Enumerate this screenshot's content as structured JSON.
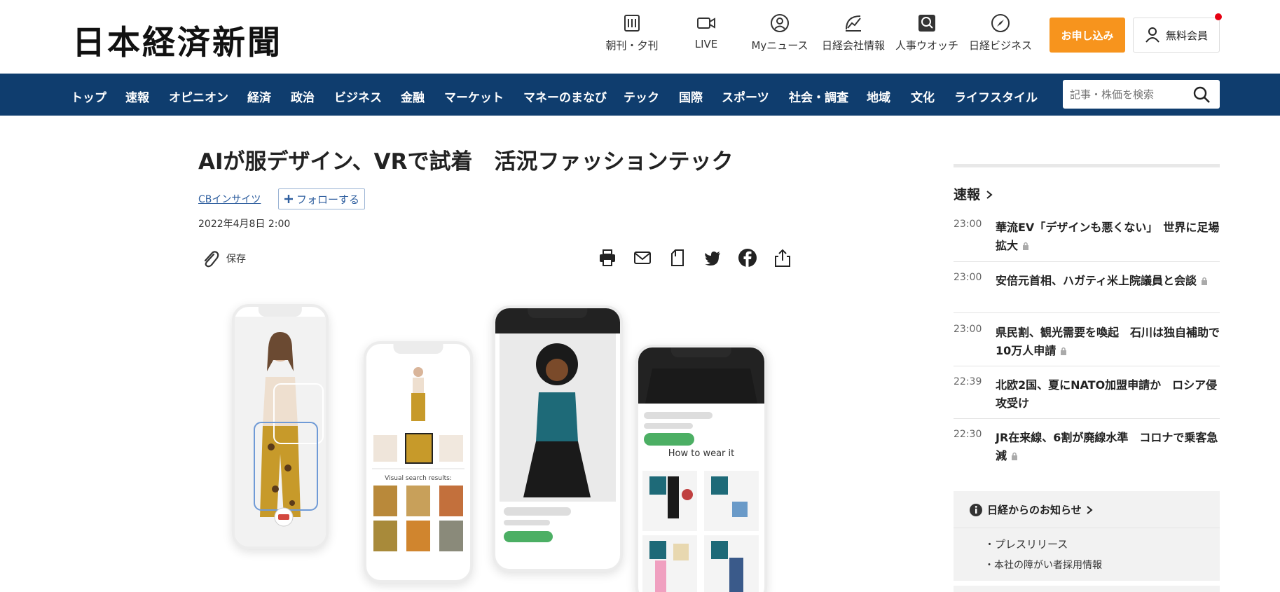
{
  "header": {
    "logo": "日本経済新聞",
    "utilities": [
      {
        "label": "朝刊・夕刊",
        "icon": "newspaper-icon"
      },
      {
        "label": "LIVE",
        "icon": "video-camera-icon"
      },
      {
        "label": "Myニュース",
        "icon": "user-circle-icon"
      },
      {
        "label": "日経会社情報",
        "icon": "chart-trend-icon"
      },
      {
        "label": "人事ウオッチ",
        "icon": "magnifier-box-icon"
      },
      {
        "label": "日経ビジネス",
        "icon": "compass-icon"
      }
    ],
    "apply_label": "お申し込み",
    "member_label": "無料会員",
    "accent_color": "#f7941d"
  },
  "nav": {
    "items": [
      "トップ",
      "速報",
      "オピニオン",
      "経済",
      "政治",
      "ビジネス",
      "金融",
      "マーケット",
      "マネーのまなび",
      "テック",
      "国際",
      "スポーツ",
      "社会・調査",
      "地域",
      "文化",
      "ライフスタイル"
    ],
    "search_placeholder": "記事・株価を検索",
    "background_color": "#0f3d6e"
  },
  "article": {
    "title": "AIが服デザイン、VRで試着　活況ファッションテック",
    "author": "CBインサイツ",
    "follow_label": "フォローする",
    "date": "2022年4月8日 2:00",
    "save_label": "保存",
    "share_icons": [
      "print-icon",
      "mail-icon",
      "bookmark-icon",
      "twitter-icon",
      "facebook-icon",
      "share-icon"
    ],
    "image": {
      "visual_search_label": "Visual search results:",
      "how_to_wear_label": "How to wear it"
    }
  },
  "sidebar": {
    "heading": "速報",
    "news": [
      {
        "time": "23:00",
        "headline": "華流EV「デザインも悪くない」　世界に足場拡大"
      },
      {
        "time": "23:00",
        "headline": "安倍元首相、ハガティ米上院議員と会談"
      },
      {
        "time": "23:00",
        "headline": "県民割、観光需要を喚起　石川は独自補助で10万人申請"
      },
      {
        "time": "22:39",
        "headline": "北欧2国、夏にNATO加盟申請か　ロシア侵攻受け"
      },
      {
        "time": "22:30",
        "headline": "JR在来線、6割が廃線水準　コロナで乗客急減"
      }
    ],
    "notice": {
      "title": "日経からのお知らせ",
      "links": [
        "プレスリリース",
        "本社の障がい者採用情報"
      ]
    }
  }
}
